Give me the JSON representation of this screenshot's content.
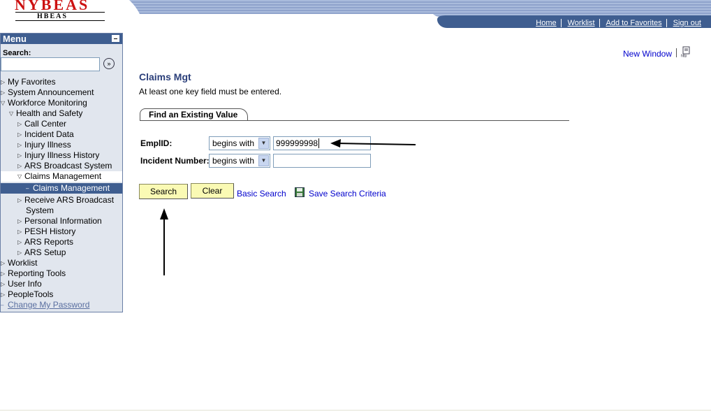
{
  "logo": {
    "top_text": "NYBEAS",
    "bottom_text": "HBEAS"
  },
  "header": {
    "nav": [
      "Home",
      "Worklist",
      "Add to Favorites",
      "Sign out"
    ]
  },
  "menu": {
    "title": "Menu",
    "search_label": "Search:",
    "search_value": "",
    "items": {
      "my_favorites": "My Favorites",
      "system_announcement": "System Announcement",
      "workforce_monitoring": "Workforce Monitoring",
      "health_and_safety": "Health and Safety",
      "call_center": "Call Center",
      "incident_data": "Incident Data",
      "injury_illness": "Injury Illness",
      "injury_illness_history": "Injury Illness History",
      "ars_broadcast_system": "ARS Broadcast System",
      "claims_management": "Claims Management",
      "claims_management_sub": "Claims Management",
      "receive_ars_1": "Receive ARS Broadcast",
      "receive_ars_2": "System",
      "personal_information": "Personal Information",
      "pesh_history": "PESH History",
      "ars_reports": "ARS Reports",
      "ars_setup": "ARS Setup",
      "worklist": "Worklist",
      "reporting_tools": "Reporting Tools",
      "user_info": "User Info",
      "peopletools": "PeopleTools",
      "change_password": "Change My Password"
    }
  },
  "content": {
    "new_window": "New Window",
    "title": "Claims Mgt",
    "instruction": "At least one key field must be entered.",
    "tab": "Find an Existing Value",
    "emplid_label": "EmplID:",
    "emplid_operator": "begins with",
    "emplid_value": "999999998",
    "incident_label": "Incident Number:",
    "incident_operator": "begins with",
    "incident_value": "",
    "search_button": "Search",
    "clear_button": "Clear",
    "basic_search": "Basic Search",
    "save_search": "Save Search Criteria"
  },
  "colors": {
    "header_blue": "#3f5e90",
    "menu_bg": "#e1e6ee",
    "button_yellow": "#fafab4",
    "title_blue": "#2b3f7a",
    "logo_red": "#cc1111"
  }
}
